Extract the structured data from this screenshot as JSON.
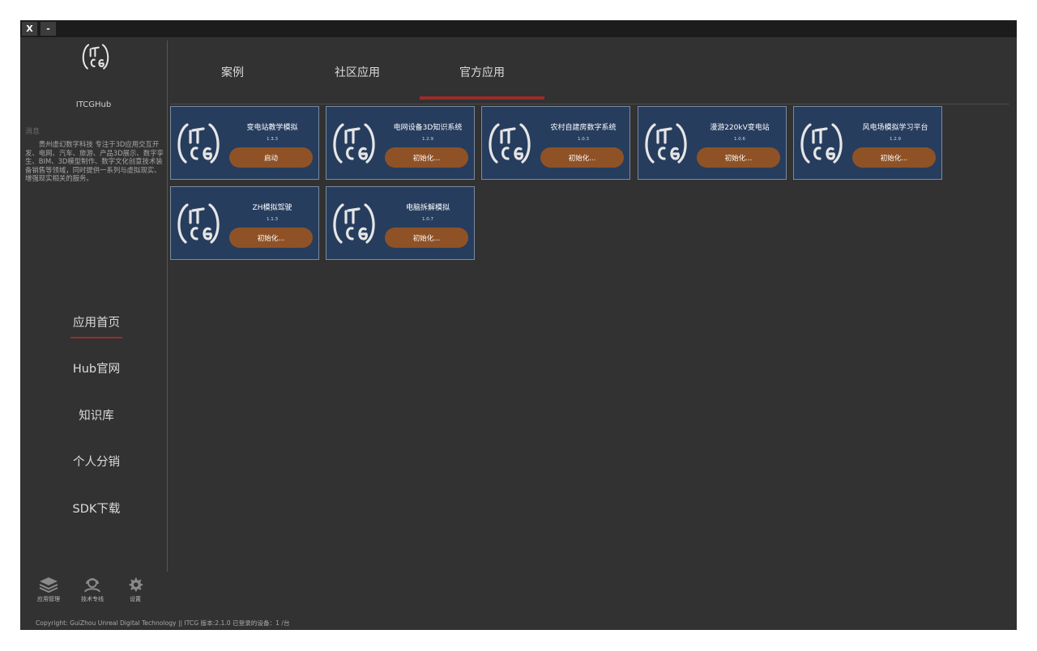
{
  "titlebar": {
    "close_label": "X",
    "minimize_label": "-"
  },
  "sidebar": {
    "logo_label": "ITCGHub",
    "message_title": "消息",
    "message_body": "贵州虚幻数字科技 专注于3D应用交互开发、电网、汽车、旅游、产品3D展示、数字孪生、BIM、3D模型制作、数字文化创意技术装备销售等领域，同时提供一系列与虚拟现实、增强现实相关的服务。",
    "nav": [
      {
        "label": "应用首页",
        "active": true
      },
      {
        "label": "Hub官网"
      },
      {
        "label": "知识库"
      },
      {
        "label": "个人分销"
      },
      {
        "label": "SDK下载"
      }
    ],
    "bottom": [
      {
        "icon": "layers-icon",
        "label": "应用管理"
      },
      {
        "icon": "support-icon",
        "label": "技术专线"
      },
      {
        "icon": "gear-icon",
        "label": "设置"
      }
    ]
  },
  "tabs": [
    {
      "label": "案例"
    },
    {
      "label": "社区应用"
    },
    {
      "label": "官方应用",
      "active": true
    }
  ],
  "apps": [
    {
      "name": "变电站教学模拟",
      "version": "1.3.3",
      "action": "启动"
    },
    {
      "name": "电网设备3D知识系统",
      "version": "1.2.9",
      "action": "初始化..."
    },
    {
      "name": "农村自建房数字系统",
      "version": "1.0.3",
      "action": "初始化..."
    },
    {
      "name": "漫游220kV变电站",
      "version": "1.0.6",
      "action": "初始化..."
    },
    {
      "name": "风电场模拟学习平台",
      "version": "1.2.9",
      "action": "初始化..."
    },
    {
      "name": "ZH模拟驾驶",
      "version": "1.1.3",
      "action": "初始化..."
    },
    {
      "name": "电脑拆解模拟",
      "version": "1.0.7",
      "action": "初始化..."
    }
  ],
  "footer": {
    "copyright": "Copyright:  GuiZhou Unreal Digital Technology || ITCG 版本:2.1.0 已登录的设备：1 /台"
  },
  "colors": {
    "background": "#323232",
    "card": "#263d5e",
    "button": "#8f5226",
    "accent": "#9c2b2b"
  }
}
